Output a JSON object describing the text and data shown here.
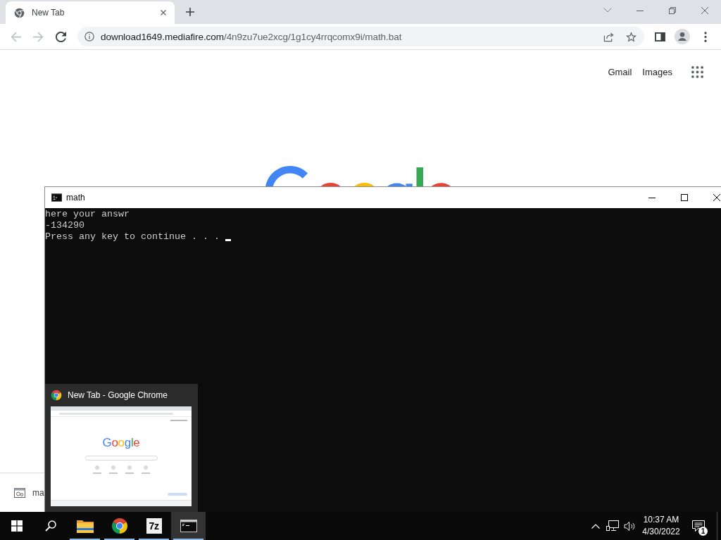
{
  "browser": {
    "tabs": [
      {
        "title": "New Tab",
        "selected": true
      }
    ],
    "nav_buttons": [
      {
        "kind": "back",
        "disabled": true
      },
      {
        "kind": "forward",
        "disabled": true
      },
      {
        "kind": "reload",
        "disabled": false
      }
    ],
    "address": {
      "host": "download1649.mediafire.com",
      "path": "/4n9zu7ue2xcg/1g1cy4rrqcomx9i/math.bat"
    },
    "header_links": [
      "Gmail",
      "Images"
    ],
    "download_shelf": {
      "file_name": "ma"
    }
  },
  "console_window": {
    "title": "math",
    "lines": [
      {
        "text": "here your answr",
        "cursor": false
      },
      {
        "text": "-134290",
        "cursor": false
      },
      {
        "text": "Press any key to continue . . .",
        "cursor": true
      }
    ]
  },
  "taskbar_preview": {
    "title": "New Tab - Google Chrome",
    "thumbnail": {
      "logo_text": "Google"
    }
  },
  "taskbar": {
    "apps": [
      {
        "kind": "folder",
        "running": true,
        "selected": false
      },
      {
        "kind": "browser",
        "running": true,
        "selected": false
      },
      {
        "kind": "archiver",
        "label": "7z",
        "running": true,
        "selected": false
      },
      {
        "kind": "console",
        "running": true,
        "selected": true
      }
    ],
    "clock": {
      "time": "10:37 AM",
      "date": "4/30/2022"
    },
    "notification_count": "1"
  }
}
